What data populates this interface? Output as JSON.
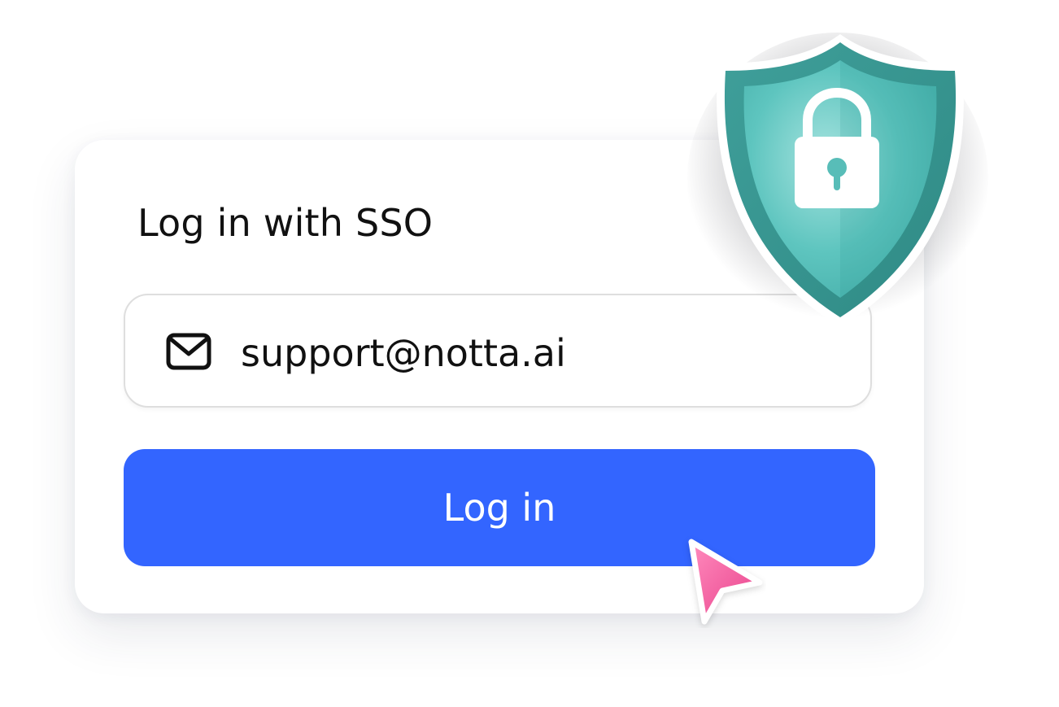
{
  "login_card": {
    "title": "Log in with SSO",
    "email_value": "support@notta.ai",
    "login_button_label": "Log in"
  },
  "icons": {
    "email": "mail-icon",
    "security": "shield-lock-icon",
    "pointer": "cursor-arrow-icon"
  },
  "colors": {
    "primary_button": "#3365ff",
    "shield_teal": "#4fb9b4",
    "cursor_pink": "#f2559a"
  }
}
